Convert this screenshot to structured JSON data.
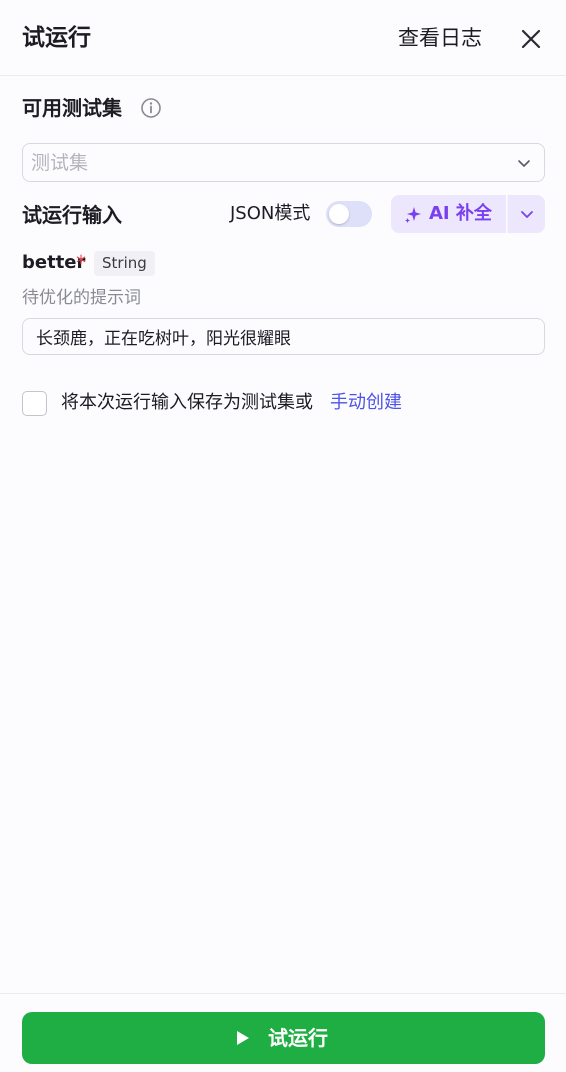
{
  "header": {
    "title": "试运行",
    "view_log_label": "查看日志"
  },
  "testset": {
    "section_title": "可用测试集",
    "select_placeholder": "测试集"
  },
  "run_input": {
    "section_title": "试运行输入",
    "json_mode_label": "JSON模式",
    "json_mode_on": false,
    "ai_complete_label": "AI 补全"
  },
  "field": {
    "name": "better",
    "required_mark": "*",
    "type": "String",
    "description": "待优化的提示词",
    "value": "长颈鹿，正在吃树叶，阳光很耀眼"
  },
  "save_option": {
    "checked": false,
    "text": "将本次运行输入保存为测试集或",
    "link": "手动创建"
  },
  "footer": {
    "run_label": "试运行"
  },
  "colors": {
    "primary_green": "#1fae43",
    "ai_purple": "#7a3ff0",
    "link_blue": "#4d53e8",
    "required_red": "#e5484d"
  }
}
